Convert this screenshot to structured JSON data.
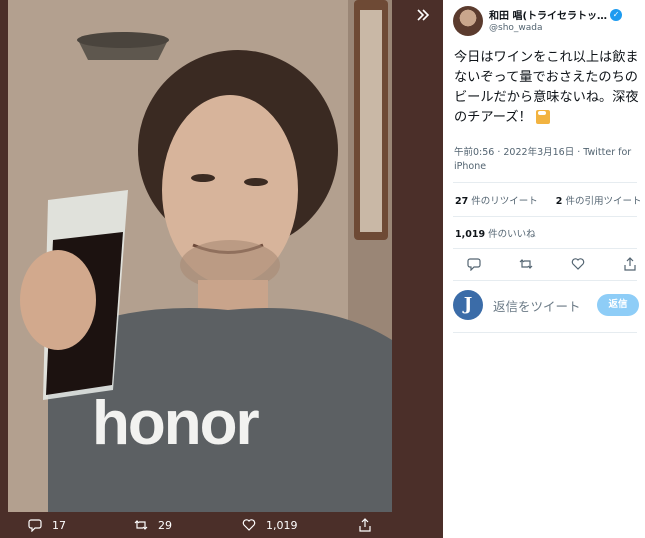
{
  "media": {
    "shirt_text": "honor",
    "actions": {
      "reply_count": "17",
      "retweet_count": "29",
      "like_count": "1,019"
    }
  },
  "tweet": {
    "author": {
      "display_name": "和田 唱(トライセラトッ…",
      "handle": "@sho_wada",
      "verified": true
    },
    "text": "今日はワインをこれ以上は飲まないぞって量でおさえたのちのビールだから意味ないね。深夜のチアーズ！",
    "timestamp": "午前0:56 · 2022年3月16日",
    "source": "Twitter for iPhone",
    "stats": {
      "retweets_num": "27",
      "retweets_label": "件のリツイート",
      "quotes_num": "2",
      "quotes_label": "件の引用ツイート",
      "likes_num": "1,019",
      "likes_label": "件のいいね"
    },
    "reply": {
      "avatar_letter": "J",
      "placeholder": "返信をツイート",
      "button_label": "返信"
    }
  },
  "colors": {
    "backdrop": "#4b2f29",
    "accent": "#1d9bf0",
    "reply_button": "#8ecdf7"
  },
  "icons": [
    "expand-icon",
    "reply-icon",
    "retweet-icon",
    "like-icon",
    "share-icon",
    "verified-badge-icon",
    "beer-emoji"
  ]
}
